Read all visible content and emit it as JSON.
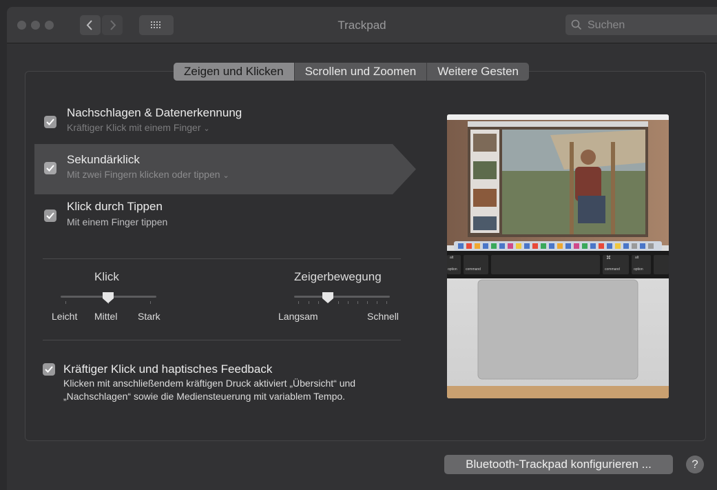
{
  "window": {
    "title": "Trackpad",
    "search_placeholder": "Suchen"
  },
  "tabs": [
    {
      "label": "Zeigen und Klicken",
      "active": true
    },
    {
      "label": "Scrollen und Zoomen",
      "active": false
    },
    {
      "label": "Weitere Gesten",
      "active": false
    }
  ],
  "options": [
    {
      "title": "Nachschlagen & Datenerkennung",
      "subtitle": "Kräftiger Klick mit einem Finger",
      "checked": true
    },
    {
      "title": "Sekundärklick",
      "subtitle": "Mit zwei Fingern klicken oder tippen",
      "checked": true
    },
    {
      "title": "Klick durch Tippen",
      "subtitle": "Mit einem Finger tippen",
      "checked": true
    }
  ],
  "sliders": {
    "click": {
      "title": "Klick",
      "labels": [
        "Leicht",
        "Mittel",
        "Stark"
      ],
      "value": "Mittel"
    },
    "tracking": {
      "title": "Zeigerbewegung",
      "min_label": "Langsam",
      "max_label": "Schnell",
      "value": 0.35
    }
  },
  "force_click": {
    "title": "Kräftiger Klick und haptisches Feedback",
    "description": "Klicken mit anschließendem kräftigen Druck aktiviert „Übersicht“ und „Nachschlagen“ sowie die Mediensteuerung mit variablem Tempo.",
    "checked": true
  },
  "preview": {
    "keys": [
      "alt",
      "option",
      "command",
      "⌘",
      "command",
      "alt",
      "option"
    ]
  },
  "buttons": {
    "bluetooth": "Bluetooth-Trackpad konfigurieren ...",
    "help": "?"
  },
  "colors": {
    "window_bg": "#323234",
    "titlebar_bg": "#3a3a3c",
    "tab_active": "#8a8a8c",
    "highlight": "#4a4a4c"
  }
}
